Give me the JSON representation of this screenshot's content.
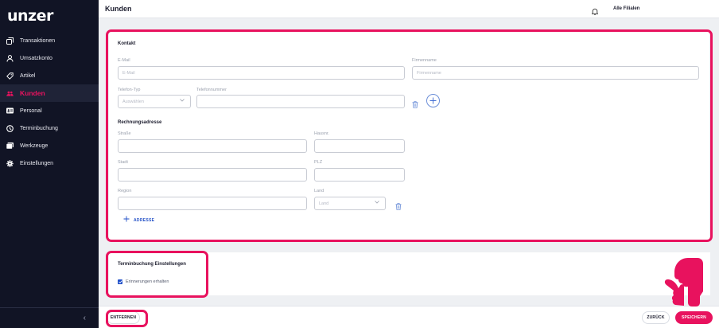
{
  "app": {
    "logo": "unzer"
  },
  "sidebar": {
    "items": [
      {
        "label": "Transaktionen",
        "icon": "transactions-icon"
      },
      {
        "label": "Umsatzkonto",
        "icon": "person-icon"
      },
      {
        "label": "Artikel",
        "icon": "tag-icon"
      },
      {
        "label": "Kunden",
        "icon": "users-icon",
        "active": true
      },
      {
        "label": "Personal",
        "icon": "id-card-icon"
      },
      {
        "label": "Terminbuchung",
        "icon": "clock-icon"
      },
      {
        "label": "Werkzeuge",
        "icon": "folder-icon"
      },
      {
        "label": "Einstellungen",
        "icon": "gear-icon"
      }
    ],
    "collapse_glyph": "‹"
  },
  "header": {
    "title": "Kunden",
    "branch": "Alle Filialen"
  },
  "contact": {
    "title": "Kontakt",
    "email_label": "E-Mail",
    "email_placeholder": "E-Mail",
    "company_label": "Firmenname",
    "company_placeholder": "Firmenname",
    "phone_type_label": "Telefon-Typ",
    "phone_type_value": "Auswählen",
    "phone_label": "Telefonnummer"
  },
  "billing": {
    "title": "Rechnungsadresse",
    "street_label": "Straße",
    "house_label": "Hausnr.",
    "city_label": "Stadt",
    "zip_label": "PLZ",
    "region_label": "Region",
    "country_label": "Land",
    "country_value": "Land",
    "add_address_label": "ADRESSE"
  },
  "booking": {
    "title": "Terminbuchung Einstellungen",
    "reminder_label": "Erinnerungen erhalten",
    "reminder_checked": true
  },
  "footer": {
    "remove_label": "ENTFERNEN",
    "back_label": "ZURÜCK",
    "save_label": "SPEICHERN"
  },
  "colors": {
    "accent": "#e8125e",
    "sidebar_bg": "#111425",
    "link_blue": "#2250c7"
  }
}
